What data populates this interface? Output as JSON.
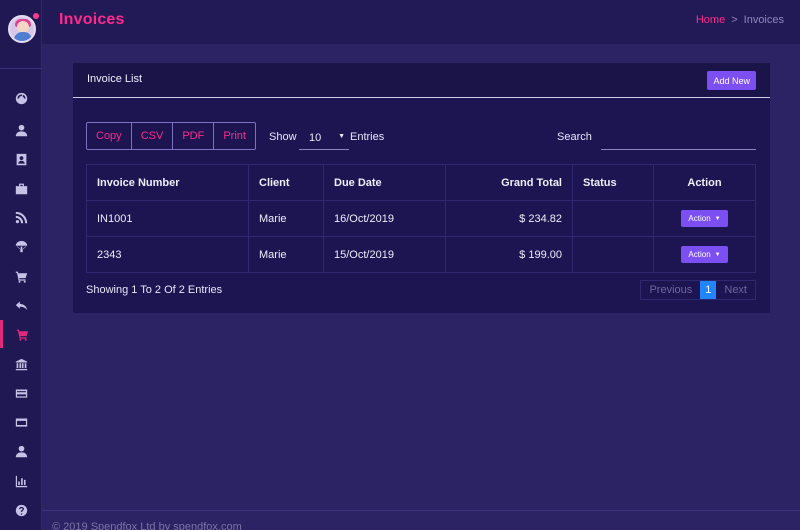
{
  "header": {
    "title": "Invoices",
    "breadcrumb": {
      "home": "Home",
      "separator": ">",
      "current": "Invoices"
    }
  },
  "sidebar": {
    "items": [
      {
        "icon": "dashboard-icon"
      },
      {
        "icon": "user-icon"
      },
      {
        "icon": "contact-card-icon"
      },
      {
        "icon": "briefcase-icon"
      },
      {
        "icon": "rss-icon"
      },
      {
        "icon": "parachute-icon"
      },
      {
        "icon": "cart-icon"
      },
      {
        "icon": "reply-all-icon"
      },
      {
        "icon": "cart-active-icon",
        "active": true
      },
      {
        "icon": "bank-icon"
      },
      {
        "icon": "credit-card-icon"
      },
      {
        "icon": "card-icon"
      },
      {
        "icon": "user-tie-icon"
      },
      {
        "icon": "bar-chart-icon"
      },
      {
        "icon": "help-icon"
      }
    ]
  },
  "card": {
    "title": "Invoice List",
    "add_label": "Add New",
    "export_buttons": [
      "Copy",
      "CSV",
      "PDF",
      "Print"
    ],
    "show_label": "Show",
    "entries_value": "10",
    "entries_label": "Entries",
    "search_label": "Search",
    "search_value": ""
  },
  "table": {
    "columns": [
      "Invoice Number",
      "Client",
      "Due Date",
      "Grand Total",
      "Status",
      "Action"
    ],
    "rows": [
      {
        "invoice": "IN1001",
        "client": "Marie",
        "due": "16/Oct/2019",
        "total": "$ 234.82",
        "status": "",
        "action": "Action"
      },
      {
        "invoice": "2343",
        "client": "Marie",
        "due": "15/Oct/2019",
        "total": "$ 199.00",
        "status": "",
        "action": "Action"
      }
    ]
  },
  "pagination": {
    "info": "Showing 1 To 2 Of 2 Entries",
    "previous": "Previous",
    "current": "1",
    "next": "Next"
  },
  "footer": {
    "text": "© 2019 Spendfox Ltd by spendfox.com"
  },
  "colors": {
    "accent": "#ff2a8a",
    "button": "#7c4ff2",
    "page_active": "#1f86ff"
  }
}
